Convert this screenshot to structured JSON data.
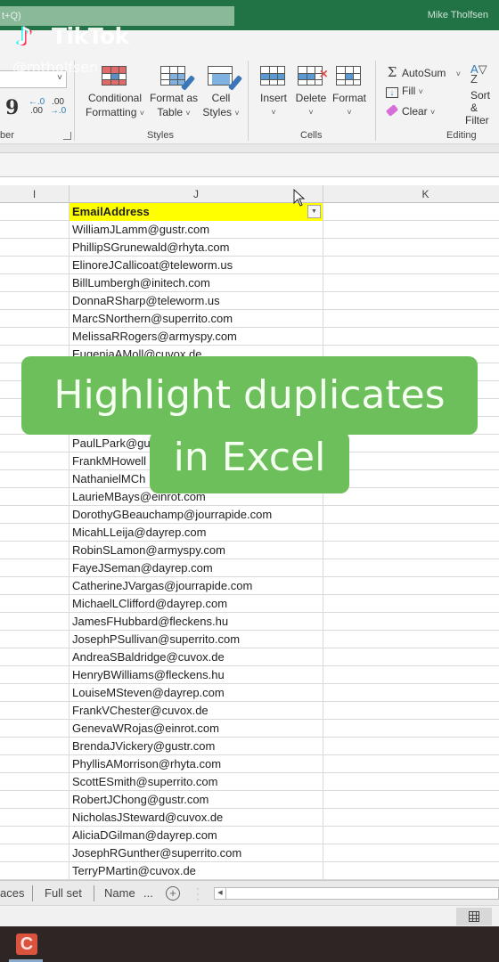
{
  "titlebar": {
    "search_hint": "t+Q)",
    "user_name": "Mike Tholfsen"
  },
  "watermark": {
    "brand": "TikTok",
    "handle": "@mtholfsen"
  },
  "ribbon": {
    "number_group_label": "ber",
    "comma_label": "9",
    "increase_decimal": {
      "top": "←.0",
      "bottom": ".00"
    },
    "decrease_decimal": {
      "top": ".00",
      "bottom": "→.0"
    },
    "styles_group_label": "Styles",
    "conditional_formatting": {
      "line1": "Conditional",
      "line2": "Formatting"
    },
    "format_as_table": {
      "line1": "Format as",
      "line2": "Table"
    },
    "cell_styles": {
      "line1": "Cell",
      "line2": "Styles"
    },
    "cells_group_label": "Cells",
    "insert_label": "Insert",
    "delete_label": "Delete",
    "format_label": "Format",
    "editing_group_label": "Editing",
    "autosum_label": "AutoSum",
    "fill_label": "Fill",
    "clear_label": "Clear",
    "sort_filter": {
      "line1": "Sort &",
      "line2": "Filter"
    },
    "chevron": "˅"
  },
  "sheet": {
    "columns": [
      "I",
      "J",
      "K"
    ],
    "header_cell": "EmailAddress",
    "header_fill": "#ffff00",
    "emails": [
      "WilliamJLamm@gustr.com",
      "PhillipSGrunewald@rhyta.com",
      "ElinoreJCallicoat@teleworm.us",
      "BillLumbergh@initech.com",
      "DonnaRSharp@teleworm.us",
      "MarcSNorthern@superrito.com",
      "MelissaRRogers@armyspy.com",
      "EugeniaAMoll@cuvox.de",
      "",
      "",
      "",
      "",
      "PaulLPark@gustr.com",
      "FrankMHowell",
      "NathanielMCh",
      "LaurieMBays@einrot.com",
      "DorothyGBeauchamp@jourrapide.com",
      "MicahLLeija@dayrep.com",
      "RobinSLamon@armyspy.com",
      "FayeJSeman@dayrep.com",
      "CatherineJVargas@jourrapide.com",
      "MichaelLClifford@dayrep.com",
      "JamesFHubbard@fleckens.hu",
      "JosephPSullivan@superrito.com",
      "AndreaSBaldridge@cuvox.de",
      "HenryBWilliams@fleckens.hu",
      "LouiseMSteven@dayrep.com",
      "FrankVChester@cuvox.de",
      "GenevaWRojas@einrot.com",
      "BrendaJVickery@gustr.com",
      "PhyllisAMorrison@rhyta.com",
      "ScottESmith@superrito.com",
      "RobertJChong@gustr.com",
      "NicholasJSteward@cuvox.de",
      "AliciaDGilman@dayrep.com",
      "JosephRGunther@superrito.com",
      "TerryPMartin@cuvox.de"
    ]
  },
  "overlay": {
    "line1": "Highlight duplicates",
    "line2": "in Excel",
    "color": "#6cbf5a"
  },
  "tabs": {
    "items": [
      "aces",
      "Full set",
      "Name"
    ],
    "more": "...",
    "add": "+"
  },
  "taskbar": {
    "app_icon_letter": "C"
  }
}
